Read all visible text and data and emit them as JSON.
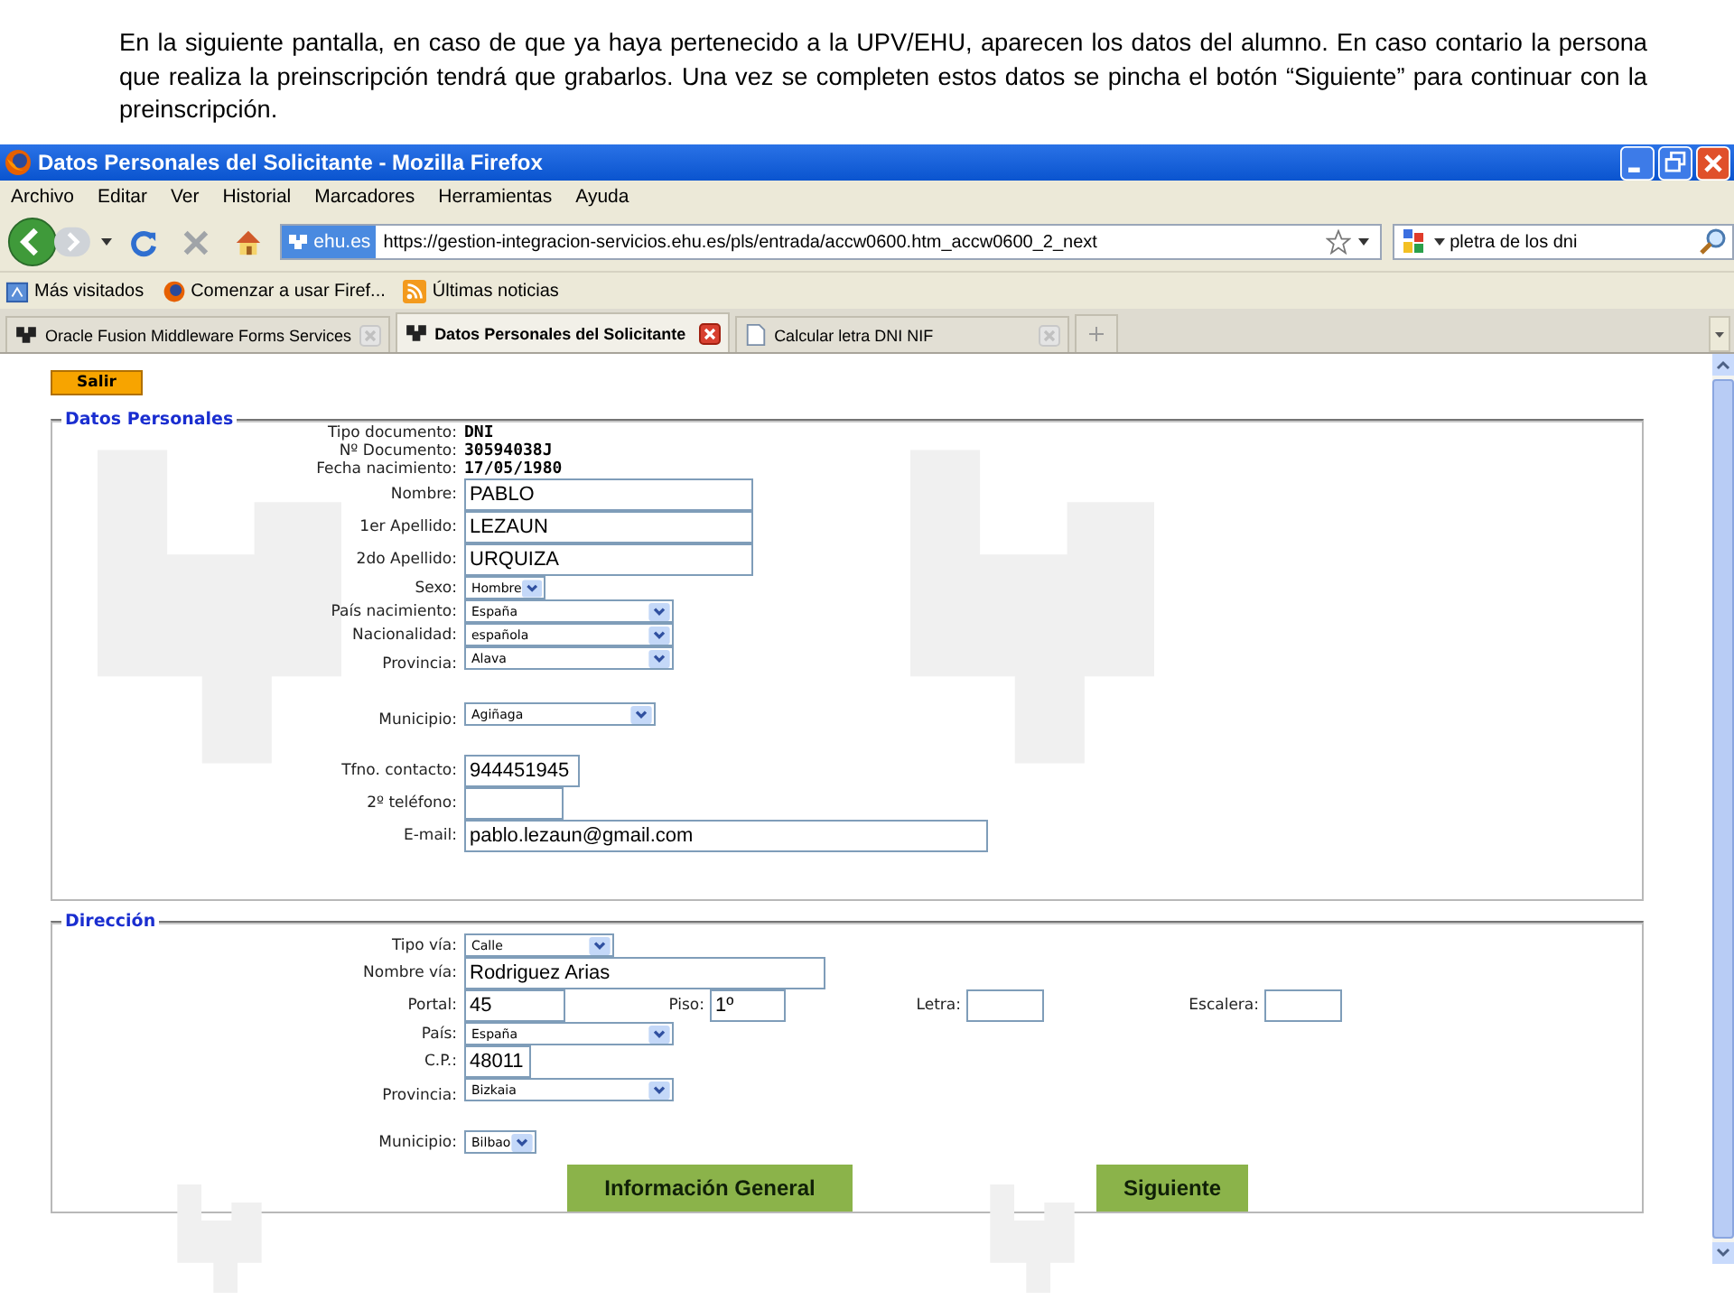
{
  "caption": "En la siguiente pantalla, en caso de que ya haya pertenecido a la UPV/EHU, aparecen los datos del alumno. En caso contario la persona que realiza la preinscripción tendrá que grabarlos. Una vez se completen estos datos se pincha el botón “Siguiente” para continuar con la preinscripción.",
  "window": {
    "title": "Datos Personales del Solicitante - Mozilla Firefox"
  },
  "menu": [
    "Archivo",
    "Editar",
    "Ver",
    "Historial",
    "Marcadores",
    "Herramientas",
    "Ayuda"
  ],
  "address_bar": {
    "site": "ehu.es",
    "url": "https://gestion-integracion-servicios.ehu.es/pls/entrada/accw0600.htm_accw0600_2_next"
  },
  "search": {
    "value": "pletra de los dni"
  },
  "bookmarks": [
    {
      "label": "Más visitados",
      "kind": "folder"
    },
    {
      "label": "Comenzar a usar Firef...",
      "kind": "firefox"
    },
    {
      "label": "Últimas noticias",
      "kind": "feed"
    }
  ],
  "tabs": [
    {
      "label": "Oracle Fusion Middleware Forms Services",
      "selected": false,
      "kind": "site"
    },
    {
      "label": "Datos Personales del Solicitante",
      "selected": true,
      "kind": "site"
    },
    {
      "label": "Calcular letra DNI NIF",
      "selected": false,
      "kind": "page"
    }
  ],
  "exit_button": "Salir",
  "sections": [
    {
      "legend": "Datos Personales",
      "rows": [
        {
          "label": "Tipo documento:",
          "kind": "static",
          "value": "DNI"
        },
        {
          "label": "Nº Documento:",
          "kind": "static",
          "value": "30594038J"
        },
        {
          "label": "Fecha nacimiento:",
          "kind": "static",
          "value": "17/05/1980"
        },
        {
          "label": "Nombre:",
          "kind": "text",
          "value": "PABLO"
        },
        {
          "label": "1er Apellido:",
          "kind": "text",
          "value": "LEZAUN"
        },
        {
          "label": "2do Apellido:",
          "kind": "text",
          "value": "URQUIZA"
        },
        {
          "label": "Sexo:",
          "kind": "select",
          "value": "Hombre"
        },
        {
          "label": "País nacimiento:",
          "kind": "select",
          "value": "España"
        },
        {
          "label": "Nacionalidad:",
          "kind": "select",
          "value": "española"
        },
        {
          "label": "Provincia:",
          "kind": "select",
          "value": "Alava"
        },
        {
          "label": "Municipio:",
          "kind": "select",
          "value": "Agiñaga"
        },
        {
          "label": "Tfno. contacto:",
          "kind": "text",
          "value": "944451945"
        },
        {
          "label": "2º teléfono:",
          "kind": "text"
        },
        {
          "label": "E-mail:",
          "kind": "text",
          "value": "pablo.lezaun@gmail.com"
        }
      ]
    },
    {
      "legend": "Dirección",
      "rows": [
        {
          "label": "Tipo vía:",
          "kind": "select",
          "value": "Calle"
        },
        {
          "label": "Nombre vía:",
          "kind": "text",
          "value": "Rodriguez Arias"
        },
        {
          "label": "Portal:",
          "kind": "text",
          "value": "45",
          "extra": [
            {
              "label": "Piso:",
              "kind": "text",
              "value": "1º"
            },
            {
              "label": "Letra:",
              "kind": "text"
            },
            {
              "label": "Escalera:",
              "kind": "text"
            }
          ]
        },
        {
          "label": "País:",
          "kind": "select",
          "value": "España"
        },
        {
          "label": "C.P.:",
          "kind": "text",
          "value": "48011"
        },
        {
          "label": "Provincia:",
          "kind": "select",
          "value": "Bizkaia"
        },
        {
          "label": "Municipio:",
          "kind": "select",
          "value": "Bilbao"
        }
      ]
    }
  ],
  "buttons": [
    "Información General",
    "Siguiente"
  ]
}
